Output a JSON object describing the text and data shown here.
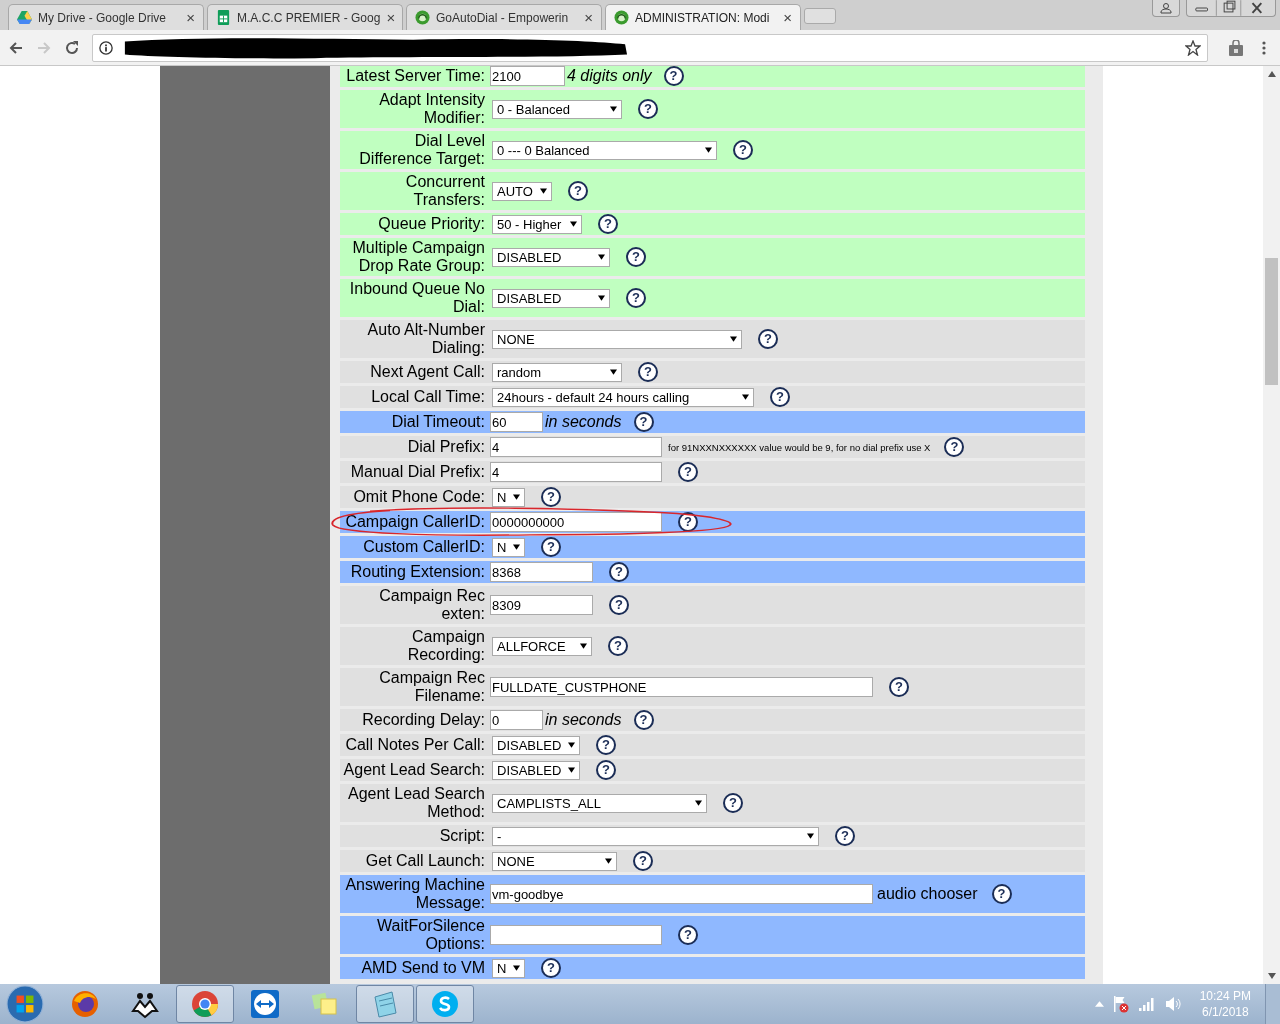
{
  "browser": {
    "tabs": [
      {
        "kind": "drive",
        "title": "My Drive - Google Drive",
        "close": "×",
        "selected": false
      },
      {
        "kind": "sheets",
        "title": "M.A.C.C PREMIER - Goog",
        "close": "×",
        "selected": false
      },
      {
        "kind": "goautodial",
        "title": "GoAutoDial - Empowerin",
        "close": "×",
        "selected": false
      },
      {
        "kind": "goautodial",
        "title": "ADMINISTRATION: Modi",
        "close": "×",
        "selected": true
      }
    ]
  },
  "rows": [
    {
      "label": "Latest Server Time:",
      "color": "#c0ffc0",
      "control": {
        "kind": "input",
        "value": "2100"
      },
      "note": {
        "kind": "italic",
        "text": "4 digits only"
      },
      "help": "?"
    },
    {
      "label": "Adapt Intensity Modifier:",
      "color": "#c0ffc0",
      "control": {
        "kind": "select",
        "value": "0 - Balanced"
      },
      "help": "?"
    },
    {
      "label": "Dial Level Difference Target:",
      "color": "#c0ffc0",
      "control": {
        "kind": "select",
        "value": "0 --- 0 Balanced"
      },
      "help": "?"
    },
    {
      "label": "Concurrent Transfers:",
      "color": "#c0ffc0",
      "control": {
        "kind": "select",
        "value": "AUTO"
      },
      "help": "?"
    },
    {
      "label": "Queue Priority:",
      "color": "#c0ffc0",
      "control": {
        "kind": "select",
        "value": "50 - Higher"
      },
      "help": "?"
    },
    {
      "label": "Multiple Campaign Drop Rate Group:",
      "color": "#c0ffc0",
      "control": {
        "kind": "select",
        "value": "DISABLED"
      },
      "help": "?"
    },
    {
      "label": "Inbound Queue No Dial:",
      "color": "#c0ffc0",
      "control": {
        "kind": "select",
        "value": "DISABLED"
      },
      "help": "?"
    },
    {
      "label": "Auto Alt-Number Dialing:",
      "color": "#e0e0e0",
      "control": {
        "kind": "select",
        "value": "NONE"
      },
      "help": "?"
    },
    {
      "label": "Next Agent Call:",
      "color": "#e0e0e0",
      "control": {
        "kind": "select",
        "value": "random"
      },
      "help": "?"
    },
    {
      "label": "Local Call Time:",
      "color": "#e0e0e0",
      "control": {
        "kind": "select",
        "value": "24hours - default 24 hours calling"
      },
      "help": "?"
    },
    {
      "label": "Dial Timeout:",
      "color": "#8fb8ff",
      "control": {
        "kind": "input",
        "value": "60"
      },
      "note": {
        "kind": "italic",
        "text": "in seconds"
      },
      "help": "?"
    },
    {
      "label": "Dial Prefix:",
      "color": "#e0e0e0",
      "control": {
        "kind": "input",
        "value": "4"
      },
      "note": {
        "kind": "small",
        "text": "for 91NXXNXXXXXX value would be 9, for no dial prefix use X"
      },
      "help": "?"
    },
    {
      "label": "Manual Dial Prefix:",
      "color": "#e0e0e0",
      "control": {
        "kind": "input",
        "value": "4"
      },
      "help": "?"
    },
    {
      "label": "Omit Phone Code:",
      "color": "#e0e0e0",
      "control": {
        "kind": "select",
        "value": "N"
      },
      "help": "?"
    },
    {
      "label": "Campaign CallerID:",
      "color": "#8fb8ff",
      "control": {
        "kind": "input",
        "value": "0000000000"
      },
      "help": "?",
      "circled": true
    },
    {
      "label": "Custom CallerID:",
      "color": "#8fb8ff",
      "control": {
        "kind": "select",
        "value": "N"
      },
      "help": "?"
    },
    {
      "label": "Routing Extension:",
      "color": "#8fb8ff",
      "control": {
        "kind": "input",
        "value": "8368"
      },
      "help": "?"
    },
    {
      "label": "Campaign Rec exten:",
      "color": "#e0e0e0",
      "control": {
        "kind": "input",
        "value": "8309"
      },
      "help": "?"
    },
    {
      "label": "Campaign Recording:",
      "color": "#e0e0e0",
      "control": {
        "kind": "select",
        "value": "ALLFORCE"
      },
      "help": "?"
    },
    {
      "label": "Campaign Rec Filename:",
      "color": "#e0e0e0",
      "control": {
        "kind": "input",
        "value": "FULLDATE_CUSTPHONE"
      },
      "help": "?"
    },
    {
      "label": "Recording Delay:",
      "color": "#e0e0e0",
      "control": {
        "kind": "input",
        "value": "0"
      },
      "note": {
        "kind": "italic",
        "text": "in seconds"
      },
      "help": "?"
    },
    {
      "label": "Call Notes Per Call:",
      "color": "#e0e0e0",
      "control": {
        "kind": "select",
        "value": "DISABLED"
      },
      "help": "?"
    },
    {
      "label": "Agent Lead Search:",
      "color": "#e0e0e0",
      "control": {
        "kind": "select",
        "value": "DISABLED"
      },
      "help": "?"
    },
    {
      "label": "Agent Lead Search Method:",
      "color": "#e0e0e0",
      "control": {
        "kind": "select",
        "value": "CAMPLISTS_ALL"
      },
      "help": "?"
    },
    {
      "label": "Script:",
      "color": "#e0e0e0",
      "control": {
        "kind": "select",
        "value": "-"
      },
      "help": "?"
    },
    {
      "label": "Get Call Launch:",
      "color": "#e0e0e0",
      "control": {
        "kind": "select",
        "value": "NONE"
      },
      "help": "?"
    },
    {
      "label": "Answering Machine Message:",
      "color": "#8fb8ff",
      "control": {
        "kind": "input",
        "value": "vm-goodbye"
      },
      "note": {
        "kind": "plain",
        "text": "audio chooser"
      },
      "help": "?"
    },
    {
      "label": "WaitForSilence Options:",
      "color": "#8fb8ff",
      "control": {
        "kind": "input"
      },
      "help": "?"
    },
    {
      "label": "AMD Send to VM",
      "color": "#8fb8ff",
      "control": {
        "kind": "select",
        "value": "N"
      },
      "help": "?"
    }
  ],
  "taskbar": {
    "items": [
      {
        "kind": "firefox",
        "running": false
      },
      {
        "kind": "people",
        "running": false
      },
      {
        "kind": "chrome",
        "running": true
      },
      {
        "kind": "teamviewer",
        "running": false
      },
      {
        "kind": "notes",
        "running": false
      },
      {
        "kind": "notepad",
        "running": true
      },
      {
        "kind": "skype",
        "running": true
      }
    ],
    "time": "10:24 PM",
    "date": "6/1/2018"
  }
}
